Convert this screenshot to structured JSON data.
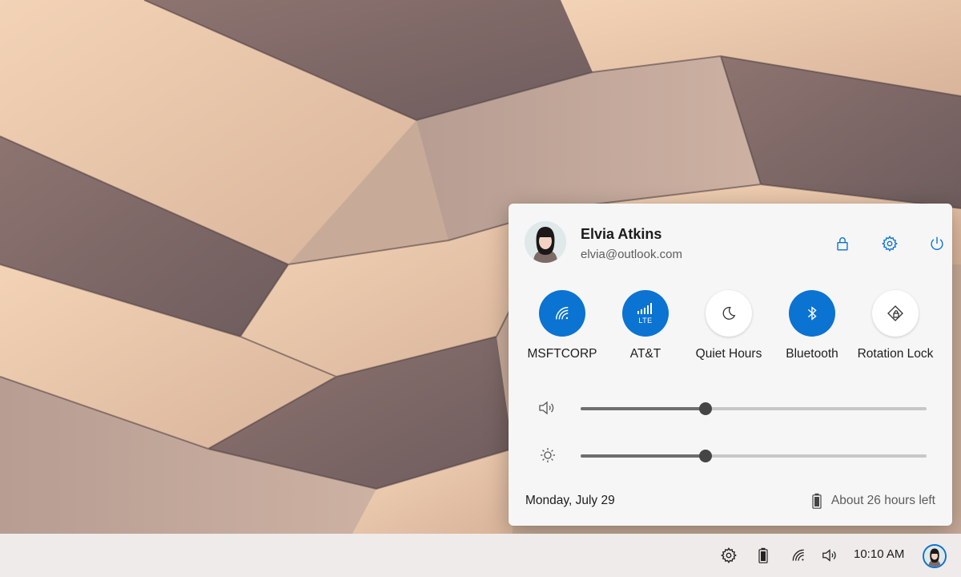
{
  "panel": {
    "user": {
      "name": "Elvia Atkins",
      "email": "elvia@outlook.com"
    },
    "header_icons": [
      "lock-icon",
      "gear-icon",
      "power-icon"
    ],
    "quick_actions": [
      {
        "label": "MSFTCORP",
        "icon": "wifi-icon",
        "state": "on"
      },
      {
        "label": "AT&T",
        "icon": "cellular-signal-icon",
        "sublabel": "LTE",
        "state": "on"
      },
      {
        "label": "Quiet Hours",
        "icon": "moon-icon",
        "state": "off"
      },
      {
        "label": "Bluetooth",
        "icon": "bluetooth-icon",
        "state": "on"
      },
      {
        "label": "Rotation Lock",
        "icon": "rotation-lock-icon",
        "state": "off"
      }
    ],
    "volume_percent": 36,
    "brightness_percent": 36,
    "date": "Monday, July 29",
    "battery_text": "About 26 hours left"
  },
  "taskbar": {
    "icons": [
      "gear-icon",
      "battery-icon",
      "wifi-icon",
      "speaker-icon"
    ],
    "time": "10:10 AM"
  },
  "colors": {
    "accent": "#0b73d1",
    "panel_bg": "#f6f6f6",
    "taskbar_bg": "#efebea"
  }
}
